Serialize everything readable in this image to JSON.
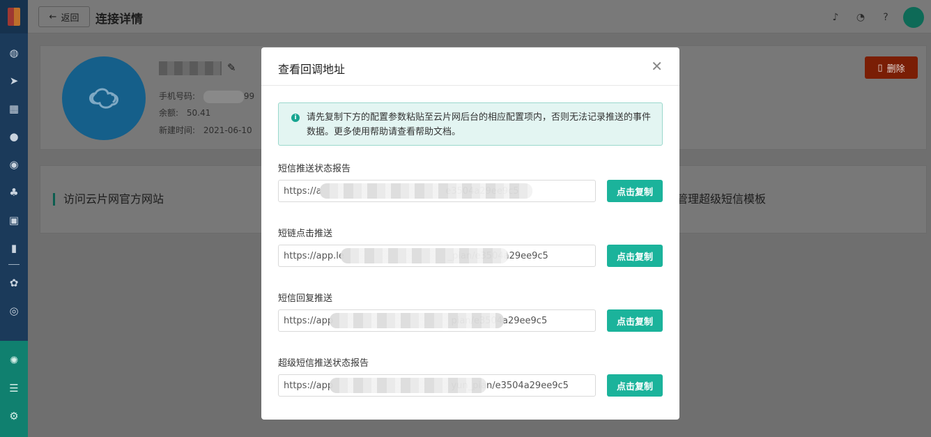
{
  "topbar": {
    "back_label": "返回",
    "page_title": "连接详情"
  },
  "sidebar": {
    "icons": [
      "dashboard-icon",
      "send-icon",
      "layout-icon",
      "user-icon",
      "users-icon",
      "group-icon",
      "bookmark-icon",
      "bar-chart-icon",
      "wechat-icon",
      "target-icon"
    ],
    "bottom_icons": [
      "hub-icon",
      "server-icon",
      "gear-icon"
    ]
  },
  "account": {
    "phone_label": "手机号码:",
    "phone_suffix": "99",
    "balance_label": "余额:",
    "balance_value": "50.41",
    "created_label": "新建时间:",
    "created_value": "2021-06-10",
    "delete_label": "删除"
  },
  "links": {
    "left": "访问云片网官方网站",
    "right": "管理超级短信模板"
  },
  "modal": {
    "title": "查看回调地址",
    "alert_text": "请先复制下方的配置参数粘贴至云片网后台的相应配置项内，否则无法记录推送的事件数据。更多使用帮助请查看帮助文档。",
    "copy_label": "点击复制",
    "fields": [
      {
        "label": "短信推送状态报告",
        "value": "https://a                                           e3504a29ee9c5"
      },
      {
        "label": "短链点击推送",
        "value": "https://app.le                                    _pian/e3504a29ee9c5"
      },
      {
        "label": "短信回复推送",
        "value": "https://app                                         pian/e3504a29ee9c5"
      },
      {
        "label": "超级短信推送状态报告",
        "value": "https://app                                         yun_pian/e3504a29ee9c5"
      }
    ]
  },
  "colors": {
    "accent": "#1bb39b",
    "danger": "#d03a0a",
    "sidebar": "#1b3a5a"
  }
}
